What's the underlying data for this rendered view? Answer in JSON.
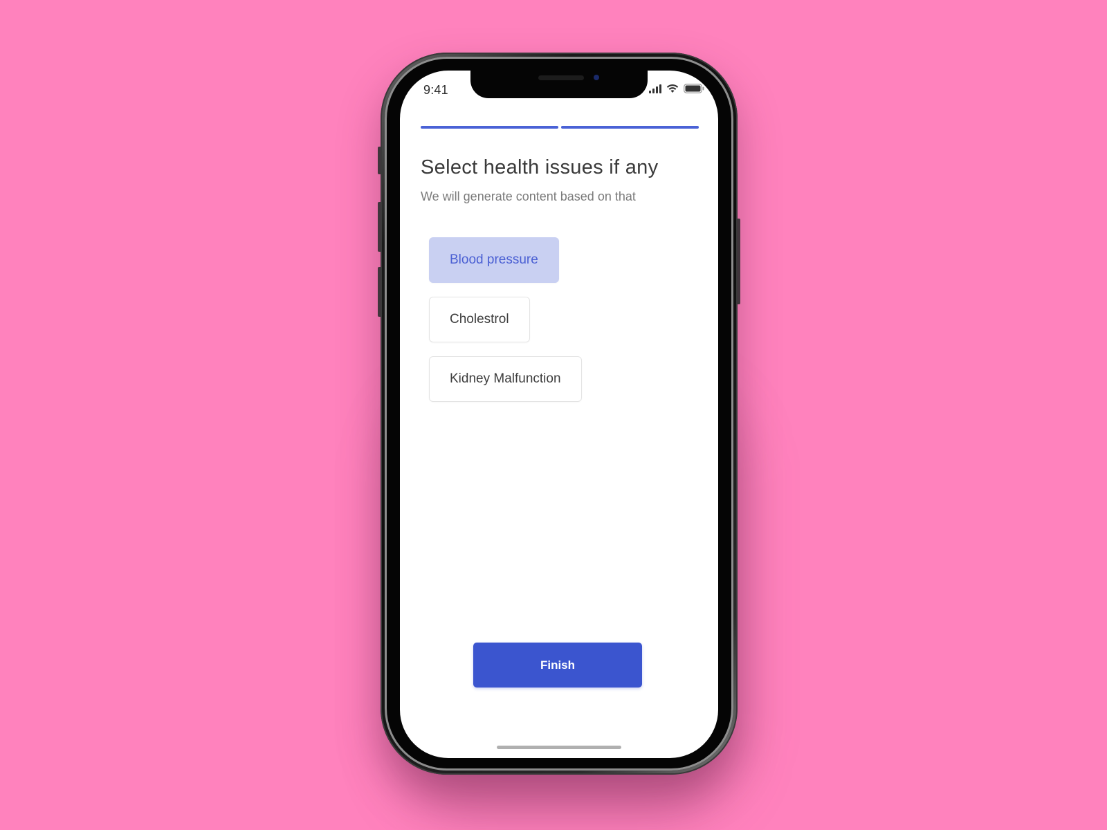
{
  "status_bar": {
    "time": "9:41",
    "icons": [
      "signal-icon",
      "wifi-icon",
      "battery-icon"
    ]
  },
  "progress": {
    "steps_total": 2,
    "steps_completed": 2
  },
  "header": {
    "title": "Select health issues if any",
    "subtitle": "We will generate content based on that"
  },
  "options": [
    {
      "label": "Blood pressure",
      "selected": true
    },
    {
      "label": "Cholestrol",
      "selected": false
    },
    {
      "label": "Kidney Malfunction",
      "selected": false
    }
  ],
  "actions": {
    "finish_label": "Finish"
  },
  "colors": {
    "background": "#ff82bd",
    "accent": "#3b55cf",
    "selected_chip_bg": "#c9d0f2",
    "selected_chip_text": "#4a5fd3"
  }
}
